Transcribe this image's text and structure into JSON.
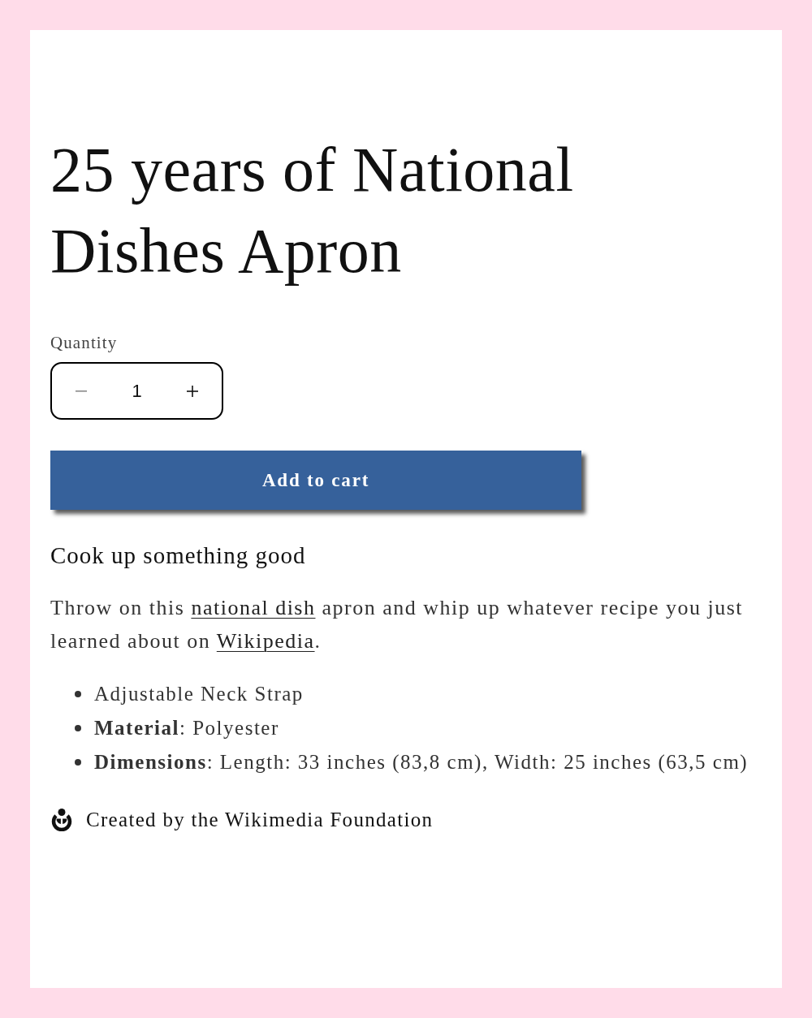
{
  "title": "25 years of National Dishes Apron",
  "quantity": {
    "label": "Quantity",
    "value": "1"
  },
  "add_to_cart": {
    "label": "Add to cart"
  },
  "description": {
    "heading": "Cook up something good",
    "paragraph": [
      {
        "kind": "text",
        "text": "Throw on this "
      },
      {
        "kind": "link",
        "text": "national dish"
      },
      {
        "kind": "text",
        "text": " apron and whip up whatever recipe you just learned about on "
      },
      {
        "kind": "link",
        "text": "Wikipedia"
      },
      {
        "kind": "text",
        "text": "."
      }
    ]
  },
  "features": [
    "Adjustable Neck Strap",
    "**Material**: Polyester",
    "**Dimensions**: Length: 33 inches (83,8 cm), Width: 25 inches (63,5 cm)"
  ],
  "credit": {
    "text": "Created by the Wikimedia Foundation"
  }
}
